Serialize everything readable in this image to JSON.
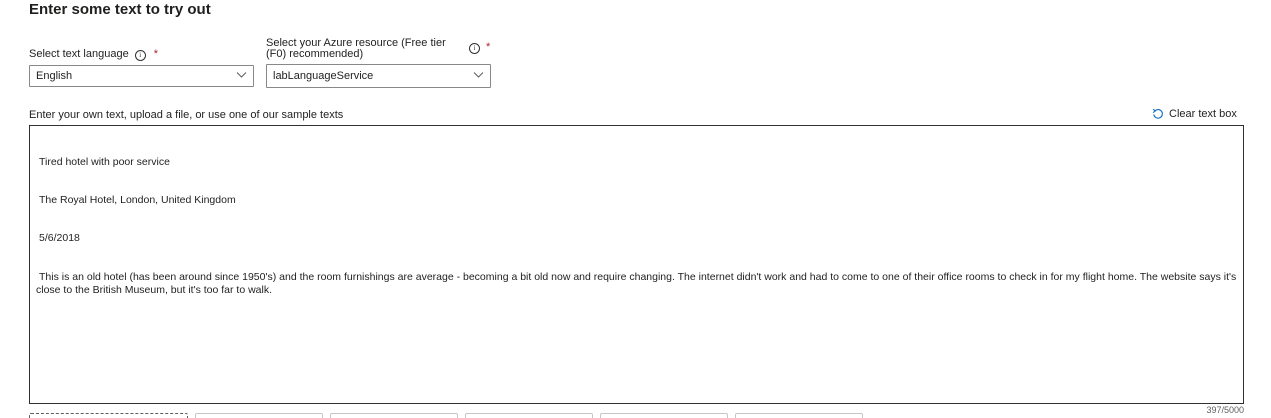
{
  "heading": "Enter some text to try out",
  "language_field": {
    "label": "Select text language",
    "required_mark": "*",
    "info_glyph": "i",
    "value": "English"
  },
  "resource_field": {
    "label_line1": "Select your Azure resource (Free tier",
    "label_line2": "(F0) recommended)",
    "required_mark": "*",
    "info_glyph": "i",
    "value": "labLanguageService"
  },
  "text_input": {
    "label": "Enter your own text, upload a file, or use one of our sample texts",
    "clear_label": "Clear text box",
    "lines": [
      "Tired hotel with poor service",
      "The Royal Hotel, London, United Kingdom",
      "5/6/2018",
      "This is an old hotel (has been around since 1950's) and the room furnishings are average - becoming a bit old now and require changing. The internet didn't work and had to come to one of their office rooms to check in for my flight home. The website says it's close to the British Museum, but it's too far to walk."
    ],
    "char_count": "397/5000"
  },
  "colors": {
    "required": "#a4262c",
    "border": "#8a8886",
    "text": "#201f1e"
  },
  "icons": {
    "info": "info-icon",
    "chevron": "chevron-down-icon",
    "clear": "refresh-icon"
  }
}
